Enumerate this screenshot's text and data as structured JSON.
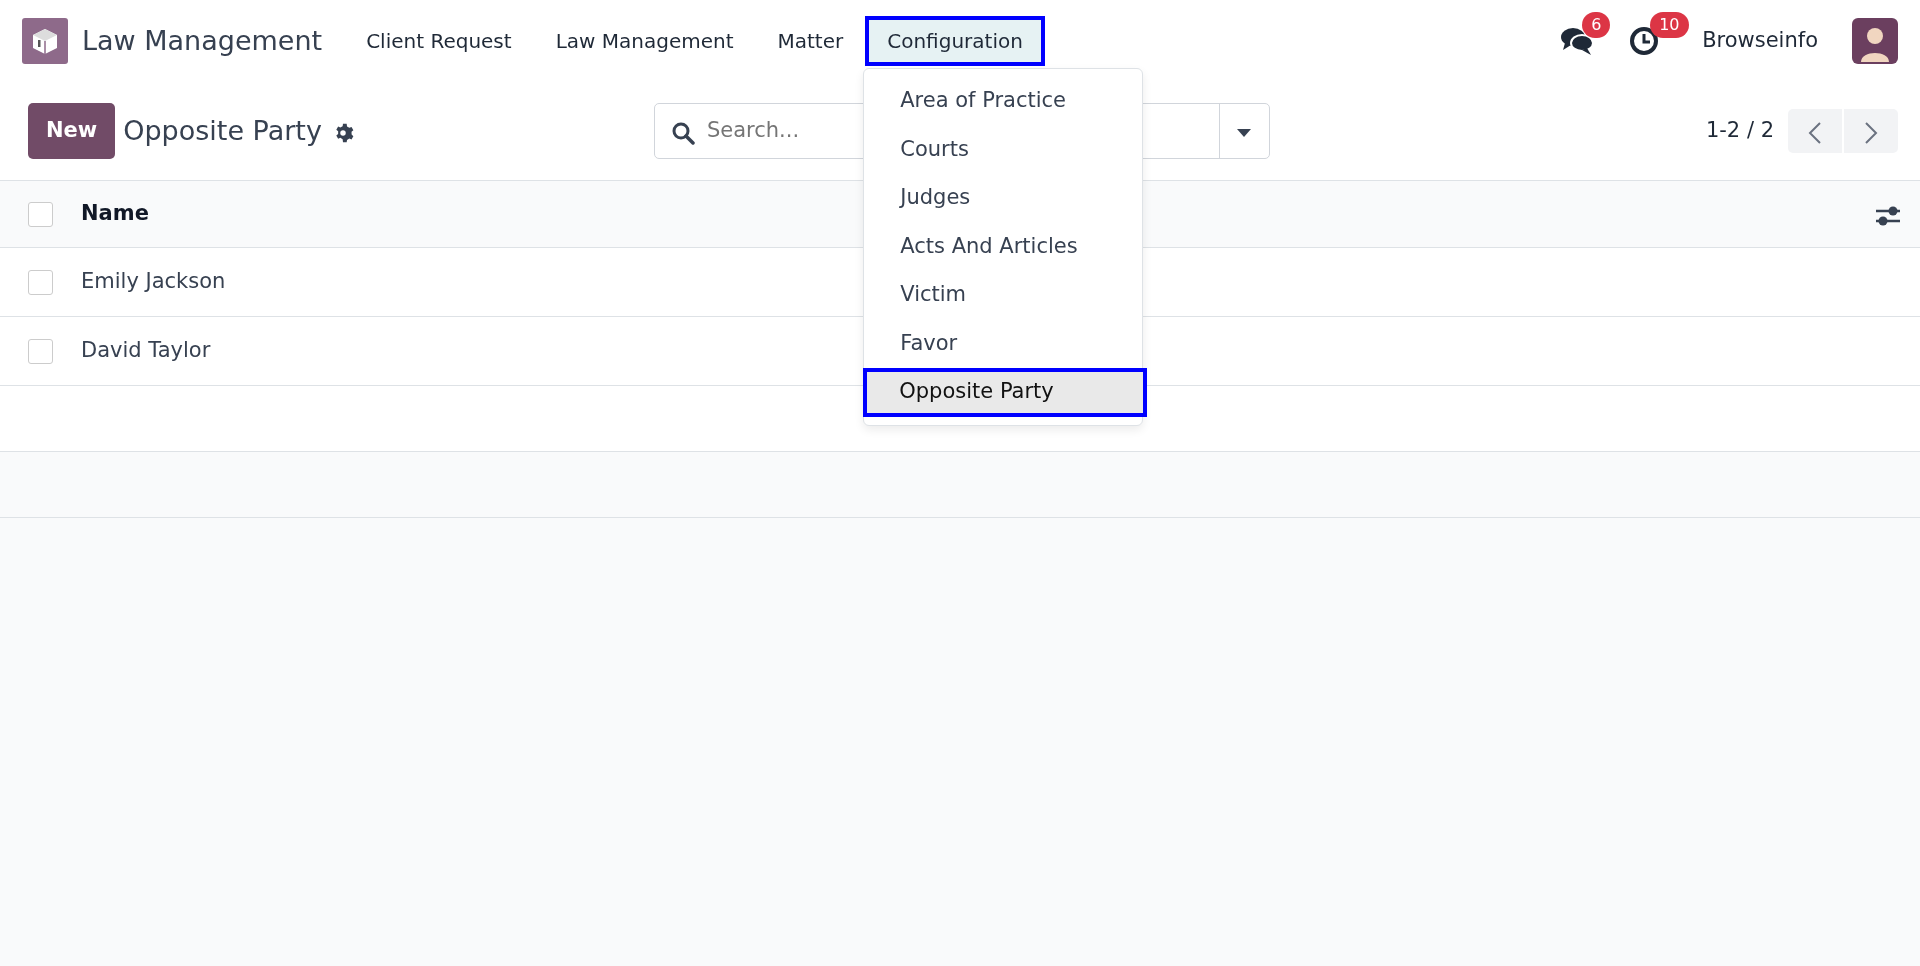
{
  "navbar": {
    "brand": "Law Management",
    "menu": [
      {
        "label": "Client Request",
        "selected": false
      },
      {
        "label": "Law Management",
        "selected": false
      },
      {
        "label": "Matter",
        "selected": false
      },
      {
        "label": "Configuration",
        "selected": true
      }
    ],
    "messages_badge": "6",
    "activities_badge": "10",
    "user": "Browseinfo"
  },
  "dropdown": {
    "items": [
      {
        "label": "Area of Practice",
        "selected": false
      },
      {
        "label": "Courts",
        "selected": false
      },
      {
        "label": "Judges",
        "selected": false
      },
      {
        "label": "Acts And Articles",
        "selected": false
      },
      {
        "label": "Victim",
        "selected": false
      },
      {
        "label": "Favor",
        "selected": false
      },
      {
        "label": "Opposite Party",
        "selected": true
      }
    ]
  },
  "control_panel": {
    "new_button": "New",
    "title": "Opposite Party",
    "search": {
      "placeholder": "Search..."
    },
    "pager": "1-2 / 2"
  },
  "list": {
    "select_all_checked": false,
    "columns": [
      "Name"
    ],
    "rows": [
      {
        "name": "Emily Jackson",
        "checked": false
      },
      {
        "name": "David Taylor",
        "checked": false
      }
    ]
  }
}
